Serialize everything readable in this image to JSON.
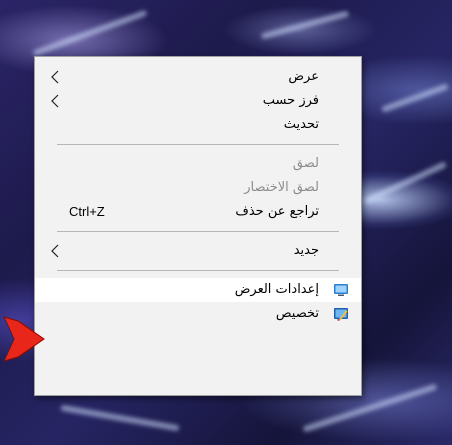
{
  "menu": {
    "groups": [
      [
        {
          "label": "عرض",
          "submenu": true
        },
        {
          "label": "فرز حسب",
          "submenu": true
        },
        {
          "label": "تحديث"
        }
      ],
      [
        {
          "label": "لصق",
          "disabled": true
        },
        {
          "label": "لصق الاختصار",
          "disabled": true
        },
        {
          "label": "تراجع عن حذف",
          "shortcut": "Ctrl+Z"
        }
      ],
      [
        {
          "label": "جديد",
          "submenu": true
        }
      ],
      [
        {
          "label": "إعدادات العرض",
          "icon": "display-icon",
          "hover": true
        },
        {
          "label": "تخصيص",
          "icon": "personalize-icon"
        }
      ]
    ]
  },
  "annotation": {
    "icon": "red-arrow-icon",
    "color": "#e8261a"
  },
  "colors": {
    "menu_bg": "#f2f2f2",
    "disabled_text": "#8c8c8c",
    "hover_bg": "#ffffff"
  }
}
